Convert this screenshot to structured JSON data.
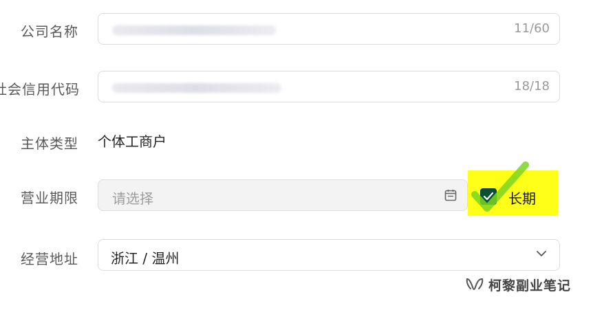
{
  "form": {
    "company_name": {
      "label": "公司名称",
      "counter": "11/60"
    },
    "credit_code": {
      "label": "社会信用代码",
      "counter": "18/18"
    },
    "entity_type": {
      "label": "主体类型",
      "value": "个体工商户"
    },
    "business_term": {
      "label": "营业期限",
      "placeholder": "请选择",
      "checkbox_label": "长期",
      "checked": true
    },
    "address": {
      "label": "经营地址",
      "value": "浙江 / 温州"
    }
  },
  "watermark": {
    "text": "柯黎副业笔记",
    "icon": "wechat-channel-icon"
  },
  "colors": {
    "highlight": "#ffff17",
    "checkbox": "#0b4f35",
    "tick_overlay": "#7dd322"
  }
}
